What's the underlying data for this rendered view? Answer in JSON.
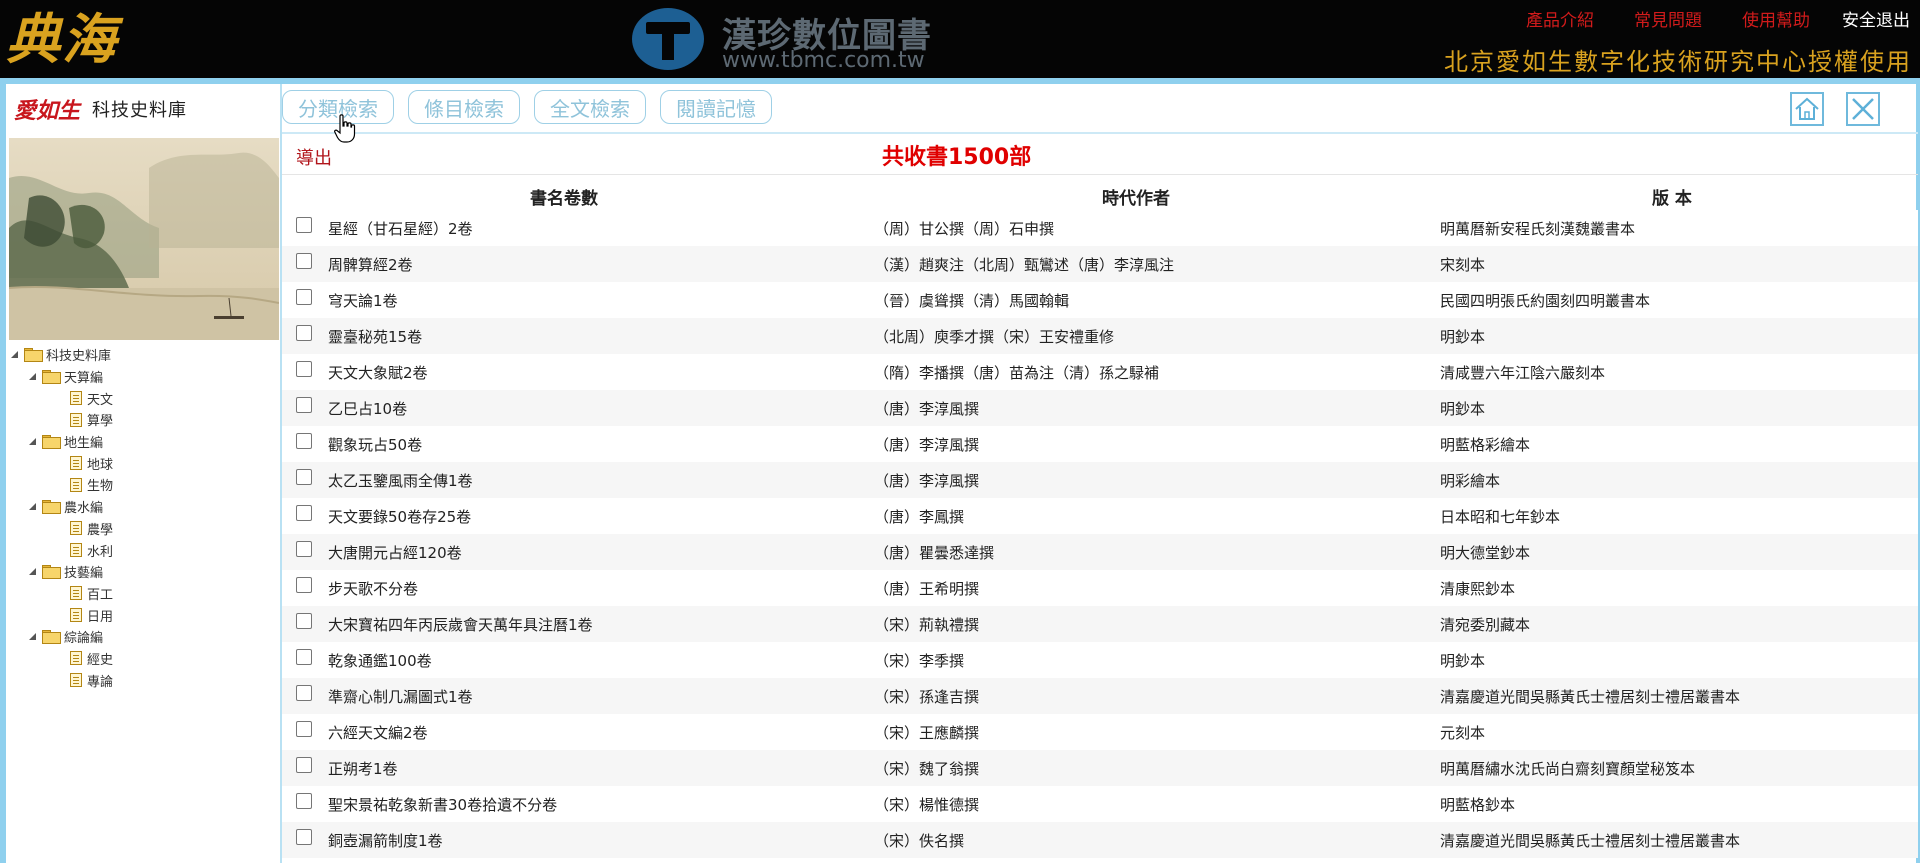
{
  "header": {
    "brand": "典海",
    "center_logo_cn": "漢珍數位圖書",
    "center_logo_url": "www.tbmc.com.tw",
    "links": [
      "產品介紹",
      "常見問題",
      "使用幫助"
    ],
    "logout": "安全退出",
    "license": "北京愛如生數字化技術研究中心授權使用"
  },
  "sidebar": {
    "publisher_logo": "愛如生",
    "database_name": "科技史料庫",
    "tree": {
      "root": "科技史料庫",
      "groups": [
        {
          "label": "天算編",
          "children": [
            "天文",
            "算學"
          ]
        },
        {
          "label": "地生編",
          "children": [
            "地球",
            "生物"
          ]
        },
        {
          "label": "農水編",
          "children": [
            "農學",
            "水利"
          ]
        },
        {
          "label": "技藝編",
          "children": [
            "百工",
            "日用"
          ]
        },
        {
          "label": "綜論編",
          "children": [
            "經史",
            "專論"
          ]
        }
      ]
    }
  },
  "toolbar": {
    "tabs": [
      "分類檢索",
      "條目檢索",
      "全文檢索",
      "閱讀記憶"
    ]
  },
  "main": {
    "export_label": "導出",
    "total": "共收書1500部",
    "columns": [
      "書名卷數",
      "時代作者",
      "版 本"
    ],
    "rows": [
      [
        "星經（甘石星經）2卷",
        "（周）甘公撰（周）石申撰",
        "明萬曆新安程氏刻漢魏叢書本"
      ],
      [
        "周髀算經2卷",
        "（漢）趙爽注（北周）甄鸞述（唐）李淳風注",
        "宋刻本"
      ],
      [
        "穹天論1卷",
        "（晉）虞聳撰（清）馬國翰輯",
        "民國四明張氏約園刻四明叢書本"
      ],
      [
        "靈臺秘苑15卷",
        "（北周）庾季才撰（宋）王安禮重修",
        "明鈔本"
      ],
      [
        "天文大象賦2卷",
        "（隋）李播撰（唐）苗為注（清）孫之騄補",
        "清咸豐六年江陰六嚴刻本"
      ],
      [
        "乙巳占10卷",
        "（唐）李淳風撰",
        "明鈔本"
      ],
      [
        "觀象玩占50卷",
        "（唐）李淳風撰",
        "明藍格彩繪本"
      ],
      [
        "太乙玉鑒風雨全傳1卷",
        "（唐）李淳風撰",
        "明彩繪本"
      ],
      [
        "天文要錄50卷存25卷",
        "（唐）李鳳撰",
        "日本昭和七年鈔本"
      ],
      [
        "大唐開元占經120卷",
        "（唐）瞿曇悉達撰",
        "明大德堂鈔本"
      ],
      [
        "步天歌不分卷",
        "（唐）王希明撰",
        "清康熙鈔本"
      ],
      [
        "大宋寶祐四年丙辰歲會天萬年具注曆1卷",
        "（宋）荊執禮撰",
        "清宛委別藏本"
      ],
      [
        "乾象通鑑100卷",
        "（宋）李季撰",
        "明鈔本"
      ],
      [
        "準齋心制几漏圖式1卷",
        "（宋）孫逢吉撰",
        "清嘉慶道光間吳縣黃氏士禮居刻士禮居叢書本"
      ],
      [
        "六經天文編2卷",
        "（宋）王應麟撰",
        "元刻本"
      ],
      [
        "正朔考1卷",
        "（宋）魏了翁撰",
        "明萬曆繡水沈氏尚白齋刻寶顏堂秘笈本"
      ],
      [
        "聖宋景祐乾象新書30卷拾遺不分卷",
        "（宋）楊惟德撰",
        "明藍格鈔本"
      ],
      [
        "銅壺漏箭制度1卷",
        "（宋）佚名撰",
        "清嘉慶道光間吳縣黃氏士禮居刻士禮居叢書本"
      ]
    ]
  },
  "colors": {
    "header_bg": "#050505",
    "gold": "#d9a21f",
    "link_red": "#d11b1b",
    "frame_blue": "#8fd0ee",
    "tab_text": "#8fc3da",
    "total_red": "#e00000"
  }
}
